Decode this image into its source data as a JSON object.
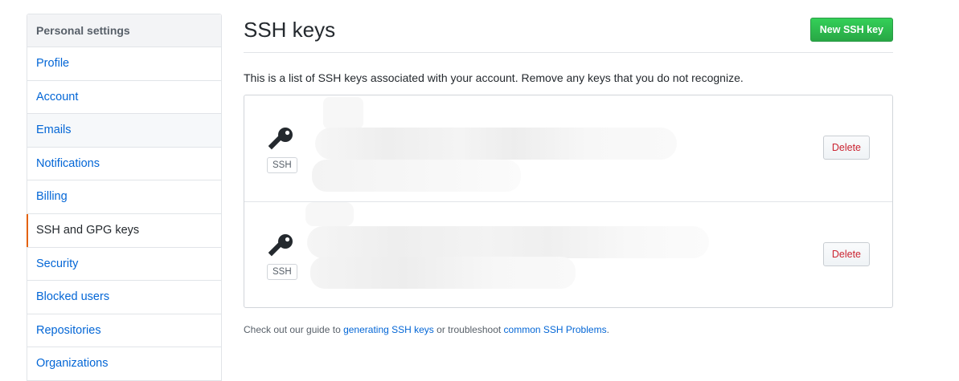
{
  "sidebar": {
    "header": "Personal settings",
    "items": [
      {
        "label": "Profile"
      },
      {
        "label": "Account"
      },
      {
        "label": "Emails"
      },
      {
        "label": "Notifications"
      },
      {
        "label": "Billing"
      },
      {
        "label": "SSH and GPG keys"
      },
      {
        "label": "Security"
      },
      {
        "label": "Blocked users"
      },
      {
        "label": "Repositories"
      },
      {
        "label": "Organizations"
      }
    ],
    "selected": "SSH and GPG keys",
    "accent_color": "#e36209"
  },
  "main": {
    "title": "SSH keys",
    "new_button_label": "New SSH key",
    "description": "This is a list of SSH keys associated with your account. Remove any keys that you do not recognize.",
    "keys": [
      {
        "icon": "key-icon",
        "badge": "SSH",
        "delete_label": "Delete"
      },
      {
        "icon": "key-icon",
        "badge": "SSH",
        "delete_label": "Delete"
      }
    ],
    "footer": {
      "prefix": "Check out our guide to ",
      "link1": "generating SSH keys",
      "middle": " or troubleshoot ",
      "link2": "common SSH Problems",
      "suffix": "."
    }
  },
  "colors": {
    "link": "#0366d6",
    "primary_button": "#28a745",
    "danger_text": "#cb2431"
  }
}
